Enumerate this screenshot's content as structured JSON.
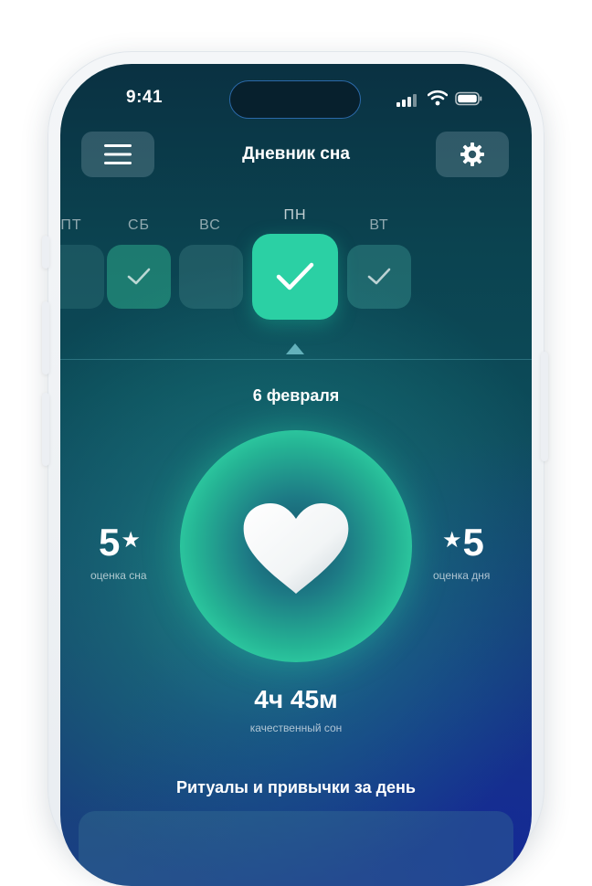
{
  "status_bar": {
    "time": "9:41"
  },
  "header": {
    "title": "Дневник сна",
    "menu_icon": "hamburger-menu-icon",
    "settings_icon": "gear-icon"
  },
  "week": {
    "days": [
      {
        "label": "ПТ",
        "state": "faint"
      },
      {
        "label": "СБ",
        "state": "done"
      },
      {
        "label": "ВС",
        "state": "empty"
      },
      {
        "label": "ПН",
        "state": "active-done"
      },
      {
        "label": "ВТ",
        "state": "done"
      }
    ]
  },
  "selected_date": "6 февраля",
  "sleep_score": {
    "value": "5",
    "star": "★",
    "caption": "оценка сна"
  },
  "day_score": {
    "value": "5",
    "star": "★",
    "caption": "оценка дня"
  },
  "center_icon": "heart-icon",
  "duration": {
    "value": "4ч 45м",
    "caption": "качественный сон"
  },
  "rituals": {
    "title": "Ритуалы и привычки за день"
  },
  "colors": {
    "accent": "#2bd0a4",
    "background_top": "#0a3142",
    "background_bottom": "#1a3f86"
  }
}
